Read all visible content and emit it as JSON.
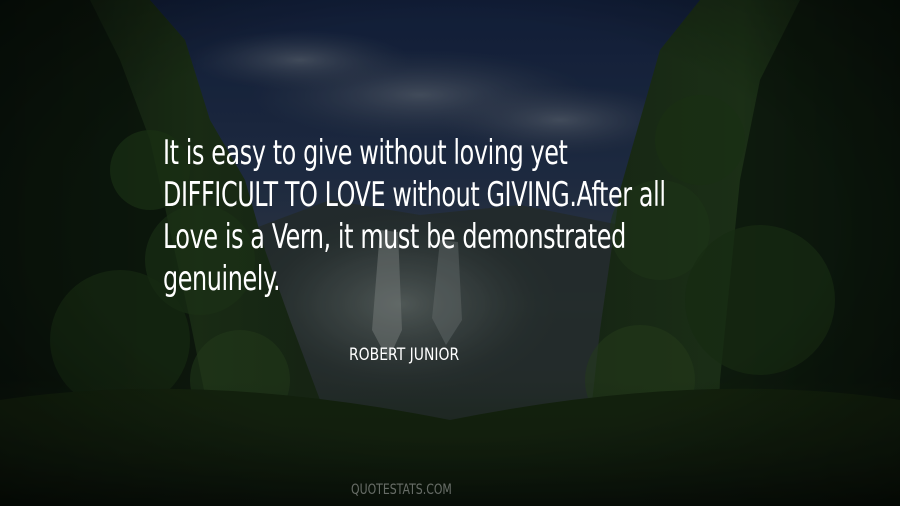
{
  "quote": {
    "lines": [
      "It is easy to give without loving yet",
      "DIFFICULT TO LOVE without GIVING.After all",
      "Love is a Vern, it must be demonstrated",
      "genuinely."
    ]
  },
  "author": "ROBERT JUNIOR",
  "watermark": "QUOTESTATS.COM",
  "colors": {
    "text": "#ffffff",
    "sky": "#1d2b48",
    "foliage_dark": "#0f1e12",
    "foliage_mid": "#26401f",
    "waterfall_mist": "#5a6666"
  }
}
